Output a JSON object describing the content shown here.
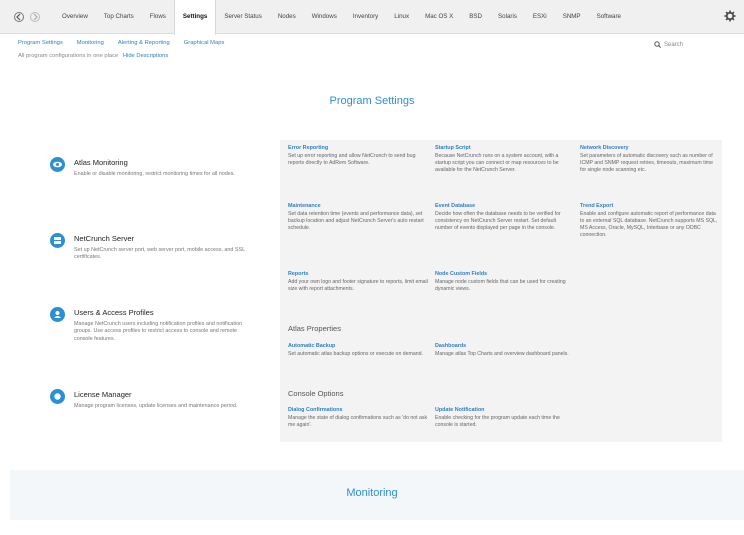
{
  "topnav": {
    "tabs": [
      {
        "label": "Overview",
        "active": false
      },
      {
        "label": "Top Charts",
        "active": false
      },
      {
        "label": "Flows",
        "active": false
      },
      {
        "label": "Settings",
        "active": true
      },
      {
        "label": "Server Status",
        "active": false
      },
      {
        "label": "Nodes",
        "active": false
      },
      {
        "label": "Windows",
        "active": false
      },
      {
        "label": "Inventory",
        "active": false
      },
      {
        "label": "Linux",
        "active": false
      },
      {
        "label": "Mac OS X",
        "active": false
      },
      {
        "label": "BSD",
        "active": false
      },
      {
        "label": "Solaris",
        "active": false
      },
      {
        "label": "ESXi",
        "active": false
      },
      {
        "label": "SNMP",
        "active": false
      },
      {
        "label": "Software",
        "active": false
      }
    ]
  },
  "subnav": {
    "links": [
      "Program Settings",
      "Monitoring",
      "Alerting & Reporting",
      "Graphical Maps"
    ],
    "description": "All program configurations in one place",
    "hide_label": "Hide Descriptions",
    "search_placeholder": "Search"
  },
  "main": {
    "section_title": "Program Settings",
    "categories": [
      {
        "title": "Atlas Monitoring",
        "description": "Enable or disable monitoring, restrict monitoring times for all nodes.",
        "icon": "eye-icon"
      },
      {
        "title": "NetCrunch Server",
        "description": "Set up NetCrunch server port, web server port, mobile access, and SSL certificates.",
        "icon": "server-icon"
      },
      {
        "title": "Users & Access Profiles",
        "description": "Manage NetCrunch users including notification profiles and notification groups. Use access profiles to restrict access to console and remote console features.",
        "icon": "users-icon"
      },
      {
        "title": "License Manager",
        "description": "Manage program licenses, update licenses and maintenance period.",
        "icon": "license-icon"
      }
    ],
    "panel": {
      "items": [
        {
          "title": "Error Reporting",
          "description": "Set up error reporting and allow NetCrunch to send bug reports directly to AdRem Software."
        },
        {
          "title": "Startup Script",
          "description": "Because NetCrunch runs on a system account, with a startup script you can connect or map resources to be available for the NetCrunch Server."
        },
        {
          "title": "Network Discovery",
          "description": "Set parameters of automatic discovery such as number of ICMP and SNMP request retries, timeouts, maximum time for single node scanning etc."
        },
        {
          "title": "Maintenance",
          "description": "Set data retention time (events and performance data), set backup location and adjust NetCrunch Server's auto restart schedule."
        },
        {
          "title": "Event Database",
          "description": "Decide how often the database needs to be verified for consistency on NetCrunch Server restart. Set default number of events displayed per page in the console."
        },
        {
          "title": "Trend Export",
          "description": "Enable and configure automatic report of performance data to an external SQL database. NetCrunch supports MS SQL, MS Access, Oracle, MySQL, Interbase or any ODBC connection."
        },
        {
          "title": "Reports",
          "description": "Add your own logo and footer signature to reports, limit email size with report attachments."
        },
        {
          "title": "Node Custom Fields",
          "description": "Manage node custom fields that can be used for creating dynamic views."
        }
      ],
      "atlas_group": "Atlas Properties",
      "atlas_items": [
        {
          "title": "Automatic Backup",
          "description": "Set automatic atlas backup options or execute on demand."
        },
        {
          "title": "Dashboards",
          "description": "Manage atlas Top Charts and overview dashboard panels."
        }
      ],
      "console_group": "Console Options",
      "console_items": [
        {
          "title": "Dialog Confirmations",
          "description": "Manage the state of dialog confirmations such as 'do not ask me again'."
        },
        {
          "title": "Update Notification",
          "description": "Enable checking for the program update each time the console is started."
        }
      ]
    }
  },
  "bottom": {
    "section_title": "Monitoring"
  },
  "colors": {
    "accent": "#2f8fd4",
    "link": "#2f7ec7",
    "icon": "#2b8fd6",
    "panel": "#f3f3f3"
  }
}
